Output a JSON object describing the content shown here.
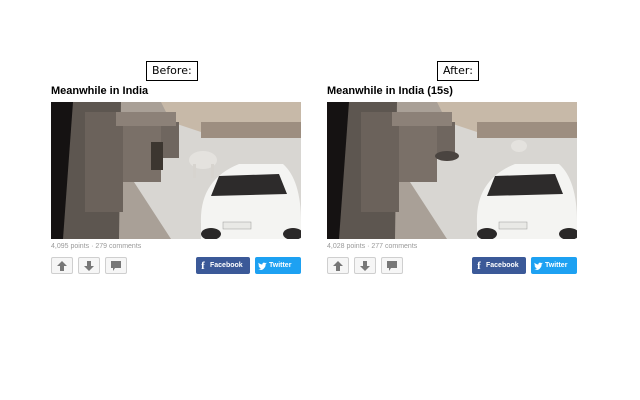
{
  "panels": [
    {
      "tag": "Before:",
      "title": "Meanwhile in India",
      "stats": "4,095 points · 279 comments",
      "upvote_icon": "arrow-up-icon",
      "downvote_icon": "arrow-down-icon",
      "comment_icon": "comment-icon",
      "facebook_label": "Facebook",
      "twitter_label": "Twitter"
    },
    {
      "tag": "After:",
      "title": "Meanwhile in India (15s)",
      "stats": "4,028 points · 277 comments",
      "upvote_icon": "arrow-up-icon",
      "downvote_icon": "arrow-down-icon",
      "comment_icon": "comment-icon",
      "facebook_label": "Facebook",
      "twitter_label": "Twitter"
    }
  ],
  "colors": {
    "facebook": "#3b5998",
    "twitter": "#1da1f2",
    "meta_text": "#9a9a9a"
  }
}
